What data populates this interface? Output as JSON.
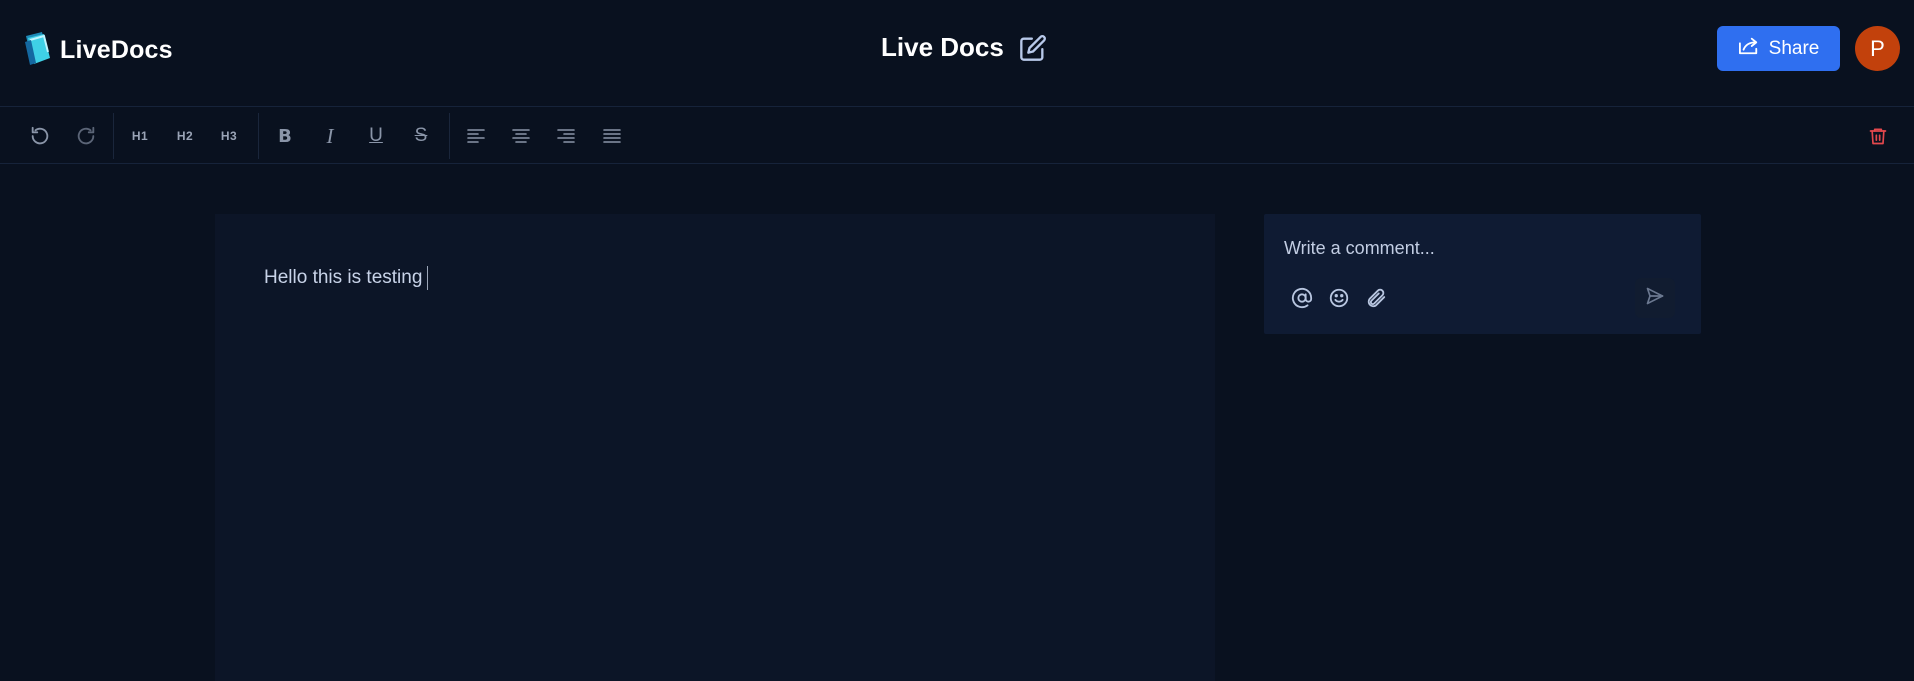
{
  "app": {
    "name": "LiveDocs"
  },
  "document": {
    "title": "Live Docs",
    "content": "Hello this is testing"
  },
  "header": {
    "share_label": "Share",
    "avatar_initial": "P"
  },
  "toolbar": {
    "h1_label": "H1",
    "h2_label": "H2",
    "h3_label": "H3",
    "icons": [
      "undo-icon",
      "redo-icon",
      "bold-icon",
      "italic-icon",
      "underline-icon",
      "strikethrough-icon",
      "align-left-icon",
      "align-center-icon",
      "align-right-icon",
      "align-justify-icon",
      "trash-icon"
    ]
  },
  "comments": {
    "placeholder": "Write a comment...",
    "icons": [
      "at-icon",
      "emoji-icon",
      "paperclip-icon",
      "send-icon"
    ]
  },
  "colors": {
    "background": "#09111f",
    "editor_bg": "#0c1527",
    "comment_bg": "#0f1b33",
    "accent": "#2f6ff0",
    "avatar": "#c2410c",
    "danger": "#e5484d"
  }
}
